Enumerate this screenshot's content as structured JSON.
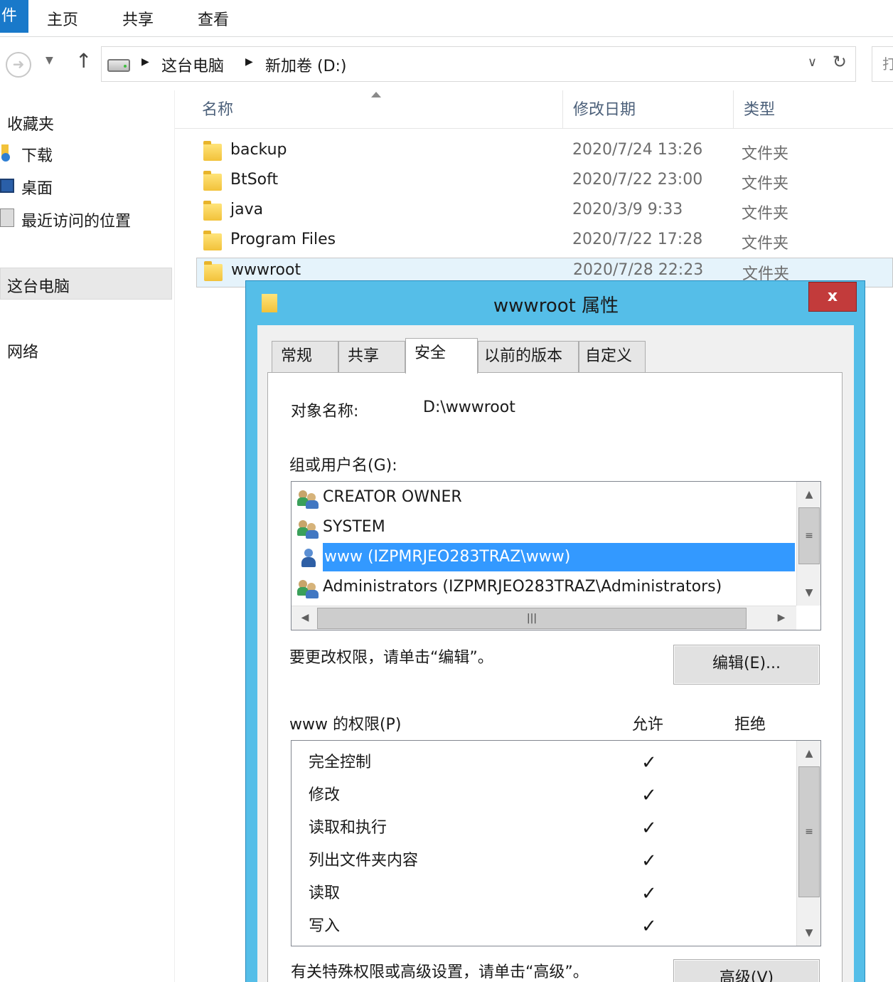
{
  "ribbon": {
    "file_tab": "件",
    "tabs": [
      "主页",
      "共享",
      "查看"
    ]
  },
  "address": {
    "crumbs": [
      "这台电脑",
      "新加卷 (D:)"
    ],
    "search_glyph": "打"
  },
  "nav": {
    "favorites": "收藏夹",
    "items": [
      "下载",
      "桌面",
      "最近访问的位置"
    ],
    "this_pc": "这台电脑",
    "network": "网络"
  },
  "filelist": {
    "columns": [
      "名称",
      "修改日期",
      "类型"
    ],
    "rows": [
      {
        "name": "backup",
        "date": "2020/7/24 13:26",
        "type": "文件夹"
      },
      {
        "name": "BtSoft",
        "date": "2020/7/22 23:00",
        "type": "文件夹"
      },
      {
        "name": "java",
        "date": "2020/3/9 9:33",
        "type": "文件夹"
      },
      {
        "name": "Program Files",
        "date": "2020/7/22 17:28",
        "type": "文件夹"
      },
      {
        "name": "wwwroot",
        "date": "2020/7/28 22:23",
        "type": "文件夹"
      }
    ]
  },
  "dialog": {
    "title": "wwwroot 属性",
    "close": "x",
    "tabs": [
      "常规",
      "共享",
      "安全",
      "以前的版本",
      "自定义"
    ],
    "object_label": "对象名称:",
    "object_value": "D:\\wwwroot",
    "group_label": "组或用户名(G):",
    "users": [
      {
        "name": "CREATOR OWNER",
        "icon": "group-icon"
      },
      {
        "name": "SYSTEM",
        "icon": "group-icon"
      },
      {
        "name": "www (IZPMRJEO283TRAZ\\www)",
        "icon": "user-icon"
      },
      {
        "name": "Administrators (IZPMRJEO283TRAZ\\Administrators)",
        "icon": "group-icon"
      }
    ],
    "selected_user_index": 2,
    "change_hint": "要更改权限，请单击“编辑”。",
    "edit_button": "编辑(E)...",
    "perm_label": "www 的权限(P)",
    "allow_label": "允许",
    "deny_label": "拒绝",
    "permissions": [
      {
        "name": "完全控制",
        "allow": "✓"
      },
      {
        "name": "修改",
        "allow": "✓"
      },
      {
        "name": "读取和执行",
        "allow": "✓"
      },
      {
        "name": "列出文件夹内容",
        "allow": "✓"
      },
      {
        "name": "读取",
        "allow": "✓"
      },
      {
        "name": "写入",
        "allow": "✓"
      }
    ],
    "advanced_hint": "有关特殊权限或高级设置，请单击“高级”。",
    "advanced_button": "高级(V)"
  },
  "scroll_glyphs": {
    "up": "▲",
    "down": "▼",
    "left": "◀",
    "right": "▶",
    "grip": "≡",
    "hgrip": "|||"
  }
}
